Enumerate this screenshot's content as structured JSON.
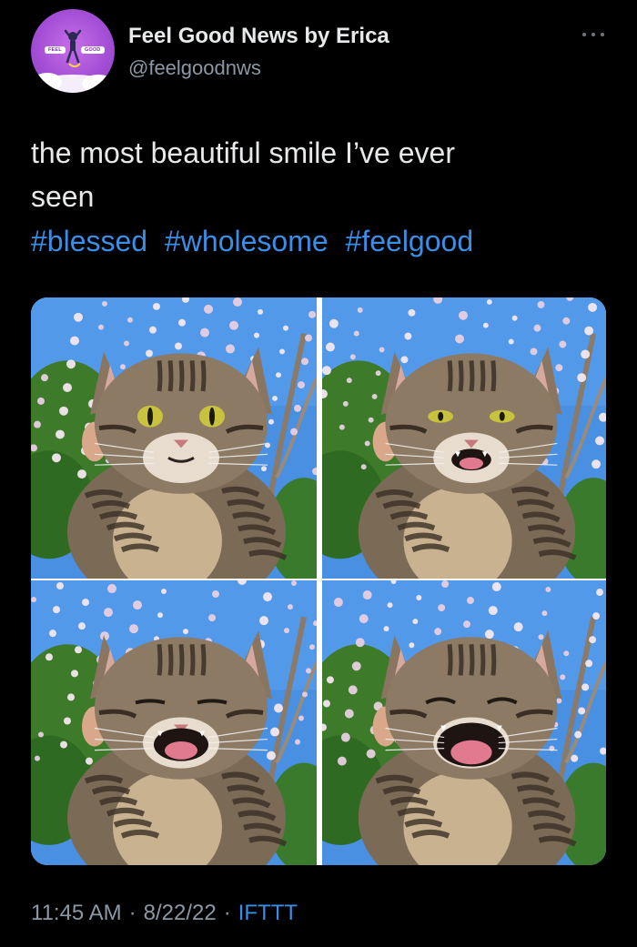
{
  "author": {
    "display_name": "Feel Good News by Erica",
    "handle": "@feelgoodnws",
    "avatar_text_left": "FEEL",
    "avatar_text_right": "GOOD"
  },
  "tweet": {
    "text_line_1": "the most beautiful smile I’ve ever",
    "text_line_2": "seen",
    "hashtags": [
      "#blessed",
      "#wholesome",
      "#feelgood"
    ]
  },
  "media": {
    "photos": [
      {
        "subject": "tabby cat, calm face"
      },
      {
        "subject": "tabby cat, slight smile"
      },
      {
        "subject": "tabby cat, big smile"
      },
      {
        "subject": "tabby cat, widest smile, eyes closed"
      }
    ]
  },
  "meta": {
    "time": "11:45 AM",
    "date": "8/22/22",
    "separator": "·",
    "source": "IFTTT"
  },
  "icons": {
    "more": "more-dots-icon"
  },
  "colors": {
    "background": "#000000",
    "text": "#e7e9ea",
    "secondary": "#8b98a5",
    "link": "#3a8ee6",
    "avatar": "#a44fd6"
  }
}
